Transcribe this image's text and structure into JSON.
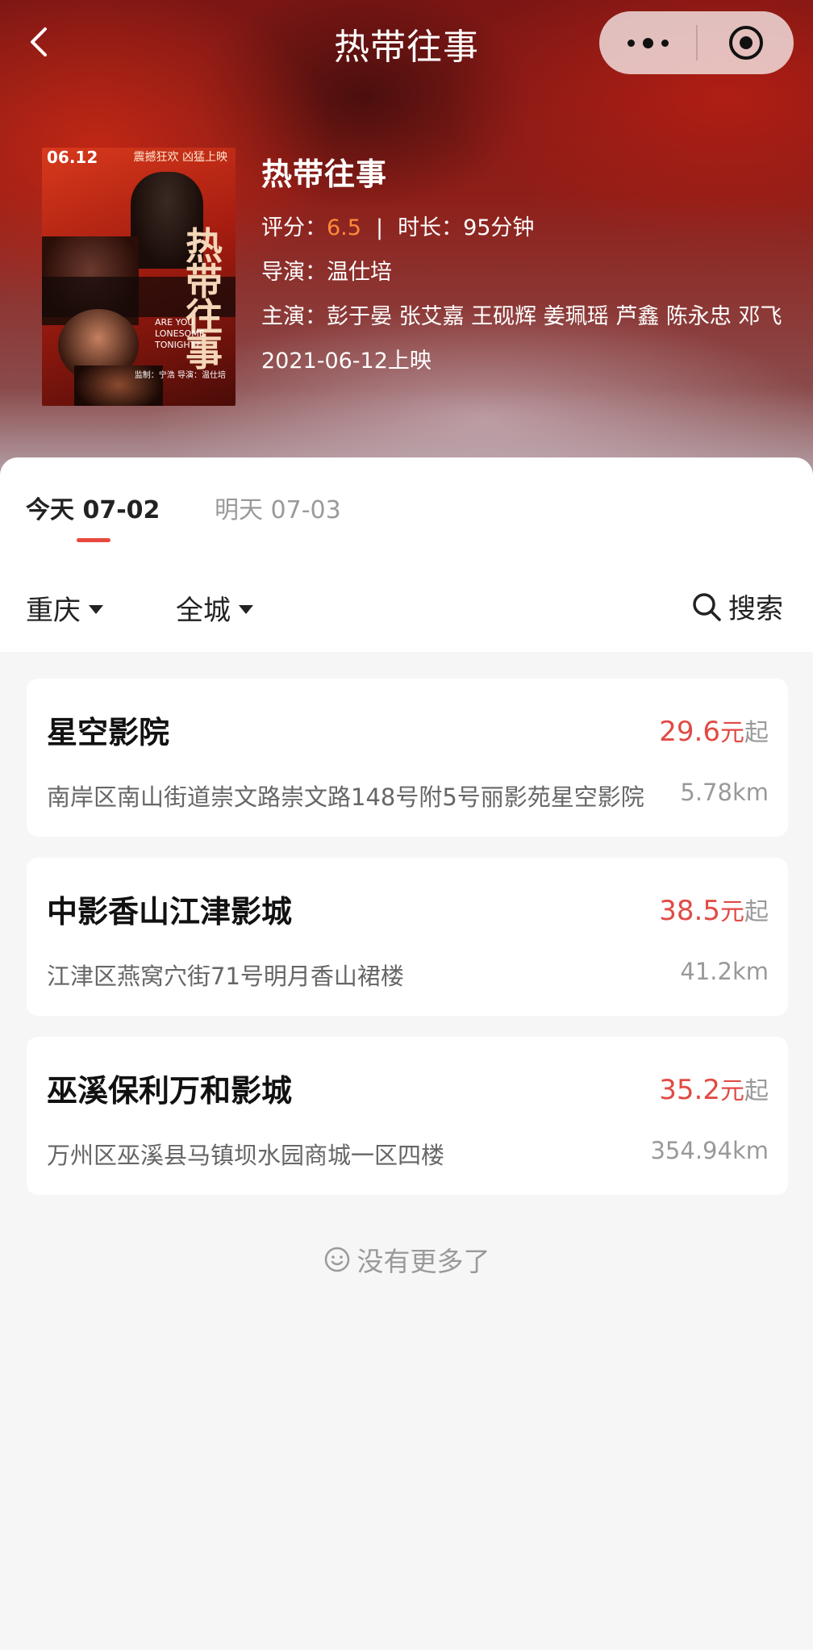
{
  "nav": {
    "title": "热带往事"
  },
  "poster": {
    "date": "06.12",
    "tagline": "震撼狂欢 凶猛上映",
    "title_cn": "热带往事",
    "title_en": "ARE YOU LONESOME TONIGHT?",
    "credit": "监制：宁浩 导演：温仕培"
  },
  "movie": {
    "title": "热带往事",
    "score_label": "评分：",
    "score": "6.5",
    "separator": "|",
    "duration_label": "时长：",
    "duration": "95分钟",
    "director_label": "导演：",
    "director": "温仕培",
    "cast_label": "主演：",
    "cast": "彭于晏 张艾嘉 王砚辉 姜珮瑶 芦鑫 陈永忠 邓飞",
    "release": "2021-06-12上映"
  },
  "tabs": [
    {
      "label": "今天 07-02",
      "active": true
    },
    {
      "label": "明天 07-03",
      "active": false
    }
  ],
  "filters": {
    "city": "重庆",
    "area": "全城",
    "search": "搜索"
  },
  "cinemas": [
    {
      "name": "星空影院",
      "price": "29.6",
      "unit": "元",
      "suffix": "起",
      "address": "南岸区南山街道崇文路崇文路148号附5号丽影苑星空影院",
      "distance": "5.78km"
    },
    {
      "name": "中影香山江津影城",
      "price": "38.5",
      "unit": "元",
      "suffix": "起",
      "address": "江津区燕窝穴街71号明月香山裙楼",
      "distance": "41.2km"
    },
    {
      "name": "巫溪保利万和影城",
      "price": "35.2",
      "unit": "元",
      "suffix": "起",
      "address": "万州区巫溪县马镇坝水园商城一区四楼",
      "distance": "354.94km"
    }
  ],
  "footer": {
    "no_more": "没有更多了"
  },
  "colors": {
    "accent": "#e04b45",
    "score": "#ff8a3a",
    "background": "#f6f6f6"
  }
}
